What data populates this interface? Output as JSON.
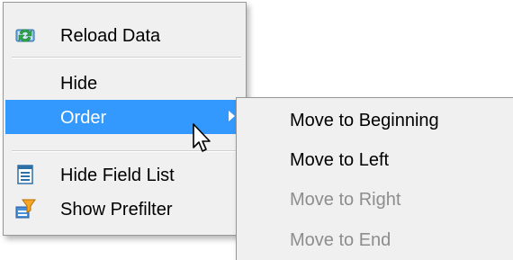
{
  "menu": {
    "items": [
      {
        "label": "Reload Data",
        "icon": "reload-icon"
      },
      {
        "label": "Hide"
      },
      {
        "label": "Order",
        "state": "highlighted",
        "has_submenu": true
      },
      {
        "label": "Hide Field List",
        "icon": "field-list-icon"
      },
      {
        "label": "Show Prefilter",
        "icon": "prefilter-icon"
      }
    ]
  },
  "submenu": {
    "items": [
      {
        "label": "Move to Beginning",
        "enabled": true
      },
      {
        "label": "Move to Left",
        "enabled": true
      },
      {
        "label": "Move to Right",
        "enabled": false
      },
      {
        "label": "Move to End",
        "enabled": false
      }
    ]
  },
  "colors": {
    "menu_background": "#f0f0f0",
    "highlight": "#3399ff",
    "highlight_text": "#ffffff",
    "disabled_text": "#8d8d8d",
    "border": "#979797"
  },
  "cursor": {
    "icon": "pointer-arrow-icon"
  }
}
